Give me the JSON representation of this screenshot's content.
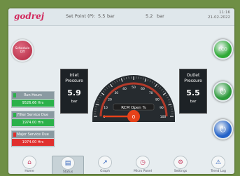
{
  "brand": "godrej",
  "topbar": {
    "set_point_label": "Set Point (P):",
    "set_point_value": "5.5",
    "set_point_unit": "bar",
    "mid_value": "5.2",
    "mid_unit": "bar",
    "clock_line1": "11:16",
    "clock_line2": "21-02-2022"
  },
  "schedule_button": "Schedule Off",
  "panels": [
    {
      "title": "Run Hours",
      "value": "9526.66 Hrs",
      "color": "#2bb14a"
    },
    {
      "title": "Filter Service Due",
      "value": "1974.00 Hrs",
      "color": "#2bb14a"
    },
    {
      "title": "Major Service Due",
      "value": "1974.00 Hrs",
      "color": "#e0302e"
    }
  ],
  "inlet": {
    "title1": "Inlet",
    "title2": "Pressure",
    "value": "5.9",
    "unit": "bar"
  },
  "outlet": {
    "title1": "Outlet",
    "title2": "Pressure",
    "value": "5.5",
    "unit": "bar"
  },
  "gauge": {
    "label": "RCM Open %",
    "value": "0",
    "min": 0,
    "max": 100,
    "ticks": [
      "0",
      "10",
      "20",
      "30",
      "40",
      "50",
      "60",
      "70",
      "80",
      "90",
      "100"
    ]
  },
  "right_buttons": [
    {
      "name": "start-button",
      "label": "ECO",
      "color": "#2faa36"
    },
    {
      "name": "power-button",
      "label": "⏻",
      "color": "#2c9a3a"
    },
    {
      "name": "stop-button",
      "label": "⏻",
      "color": "#2563c8"
    }
  ],
  "nav": [
    {
      "label": "Home",
      "glyph": "⌂",
      "name": "nav-home",
      "color": "#c83e63"
    },
    {
      "label": "Status",
      "glyph": "▤",
      "name": "nav-status",
      "color": "#2b5fb8"
    },
    {
      "label": "Graph",
      "glyph": "↗",
      "name": "nav-graph",
      "color": "#2b5fb8"
    },
    {
      "label": "Micro Panel",
      "glyph": "◷",
      "name": "nav-micro-panel",
      "color": "#c83e63"
    },
    {
      "label": "Settings",
      "glyph": "⚙",
      "name": "nav-settings",
      "color": "#c83e63"
    },
    {
      "label": "Trend Log",
      "glyph": "⚠",
      "name": "nav-trend-log",
      "color": "#2b5fb8"
    }
  ]
}
